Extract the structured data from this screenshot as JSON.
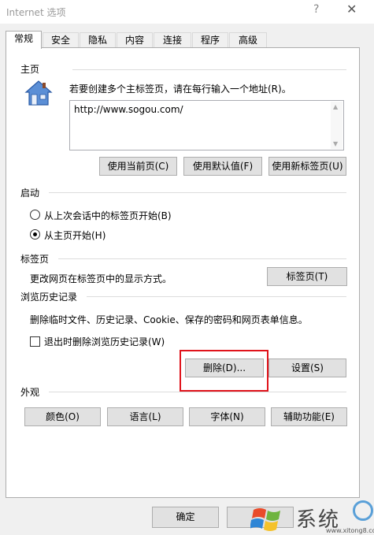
{
  "window": {
    "title": "Internet 选项",
    "help": "?",
    "close": "✕"
  },
  "tabs": [
    {
      "label": "常规"
    },
    {
      "label": "安全"
    },
    {
      "label": "隐私"
    },
    {
      "label": "内容"
    },
    {
      "label": "连接"
    },
    {
      "label": "程序"
    },
    {
      "label": "高级"
    }
  ],
  "home": {
    "section": "主页",
    "instruction": "若要创建多个主标签页，请在每行输入一个地址(R)。",
    "url": "http://www.sogou.com/",
    "buttons": {
      "current": "使用当前页(C)",
      "default": "使用默认值(F)",
      "new_tab": "使用新标签页(U)"
    },
    "icon": "house-icon"
  },
  "startup": {
    "section": "启动",
    "option_last": "从上次会话中的标签页开始(B)",
    "option_home": "从主页开始(H)",
    "selected": "option_home"
  },
  "tabs_section": {
    "section": "标签页",
    "desc": "更改网页在标签页中的显示方式。",
    "button": "标签页(T)"
  },
  "history": {
    "section": "浏览历史记录",
    "desc": "删除临时文件、历史记录、Cookie、保存的密码和网页表单信息。",
    "checkbox": "退出时删除浏览历史记录(W)",
    "checked": false,
    "delete": "删除(D)...",
    "settings": "设置(S)"
  },
  "appearance": {
    "section": "外观",
    "colors": "颜色(O)",
    "languages": "语言(L)",
    "fonts": "字体(N)",
    "accessibility": "辅助功能(E)"
  },
  "footer": {
    "ok": "确定"
  },
  "watermark": {
    "text": "系统",
    "url": "www.xitong8.com",
    "logo": "windows-flag-logo"
  },
  "colors": {
    "highlight": "#e0131b",
    "panel_bg": "#ffffff",
    "window_bg": "#f0f0f0"
  }
}
